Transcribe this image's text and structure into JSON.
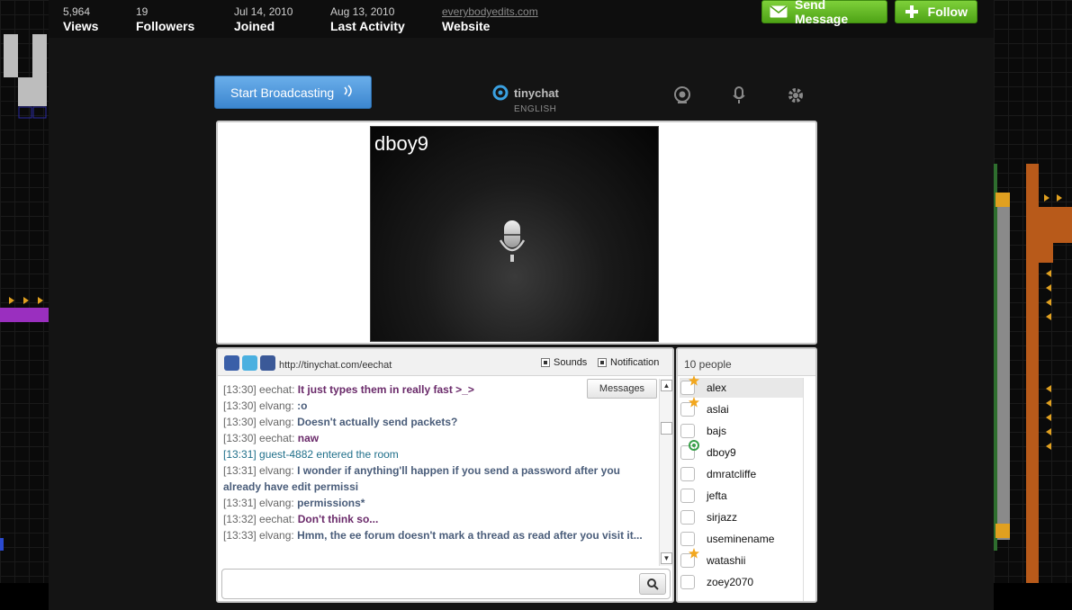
{
  "profile": {
    "stats": [
      {
        "value": "5,964",
        "label": "Views"
      },
      {
        "value": "19",
        "label": "Followers"
      },
      {
        "value": "Jul 14, 2010",
        "label": "Joined"
      },
      {
        "value": "Aug 13, 2010",
        "label": "Last Activity"
      },
      {
        "value": "everybodyedits.com",
        "label": "Website"
      }
    ],
    "send_message_label": "Send Message",
    "follow_label": "Follow"
  },
  "toolbar": {
    "broadcast_label": "Start Broadcasting",
    "brand": "tinychat",
    "language": "ENGLISH"
  },
  "video": {
    "broadcaster": "dboy9"
  },
  "chat": {
    "room_url": "http://tinychat.com/eechat",
    "sounds_label": "Sounds",
    "notification_label": "Notification",
    "messages_tab": "Messages",
    "input_value": "",
    "messages": [
      {
        "time": "[13:30]",
        "nick": "eechat:",
        "text": "It just types them in really fast >_>",
        "style": "c-purple"
      },
      {
        "time": "[13:30]",
        "nick": "elvang:",
        "text": ":o",
        "style": "c-blue"
      },
      {
        "time": "[13:30]",
        "nick": "elvang:",
        "text": "Doesn't actually send packets?",
        "style": "c-blue"
      },
      {
        "time": "[13:30]",
        "nick": "eechat:",
        "text": "naw",
        "style": "c-purple"
      },
      {
        "time": "",
        "nick": "",
        "text": "[13:31] guest-4882 entered the room",
        "style": "sys"
      },
      {
        "time": "[13:31]",
        "nick": "elvang:",
        "text": "I wonder if anything'll happen if you send a password after you already have edit permissi",
        "style": "c-blue"
      },
      {
        "time": "[13:31]",
        "nick": "elvang:",
        "text": "permissions*",
        "style": "c-blue"
      },
      {
        "time": "[13:32]",
        "nick": "eechat:",
        "text": "Don't think so...",
        "style": "c-purple"
      },
      {
        "time": "[13:33]",
        "nick": "elvang:",
        "text": "Hmm, the ee forum doesn't mark a thread as read after you visit it...",
        "style": "c-blue"
      }
    ]
  },
  "people": {
    "count_label": "10 people",
    "list": [
      {
        "name": "alex",
        "badge": "star",
        "selected": true
      },
      {
        "name": "aslai",
        "badge": "star",
        "selected": false
      },
      {
        "name": "bajs",
        "badge": "",
        "selected": false
      },
      {
        "name": "dboy9",
        "badge": "broadcasting",
        "selected": false
      },
      {
        "name": "dmratcliffe",
        "badge": "",
        "selected": false
      },
      {
        "name": "jefta",
        "badge": "",
        "selected": false
      },
      {
        "name": "sirjazz",
        "badge": "",
        "selected": false
      },
      {
        "name": "useminename",
        "badge": "",
        "selected": false
      },
      {
        "name": "watashii",
        "badge": "star",
        "selected": false
      },
      {
        "name": "zoey2070",
        "badge": "",
        "selected": false
      }
    ]
  },
  "colors": {
    "accent_blue": "#3c86cf",
    "accent_green": "#4ea316",
    "purple_text": "#6a2a6a",
    "blue_text": "#4a5d7a",
    "system_text": "#1f6f8a"
  },
  "icons": {
    "envelope": "envelope-icon",
    "plus": "plus-icon",
    "broadcast": "broadcast-waves-icon",
    "webcam": "webcam-icon",
    "microphone": "microphone-icon",
    "settings": "gear-icon",
    "search": "search-icon"
  }
}
